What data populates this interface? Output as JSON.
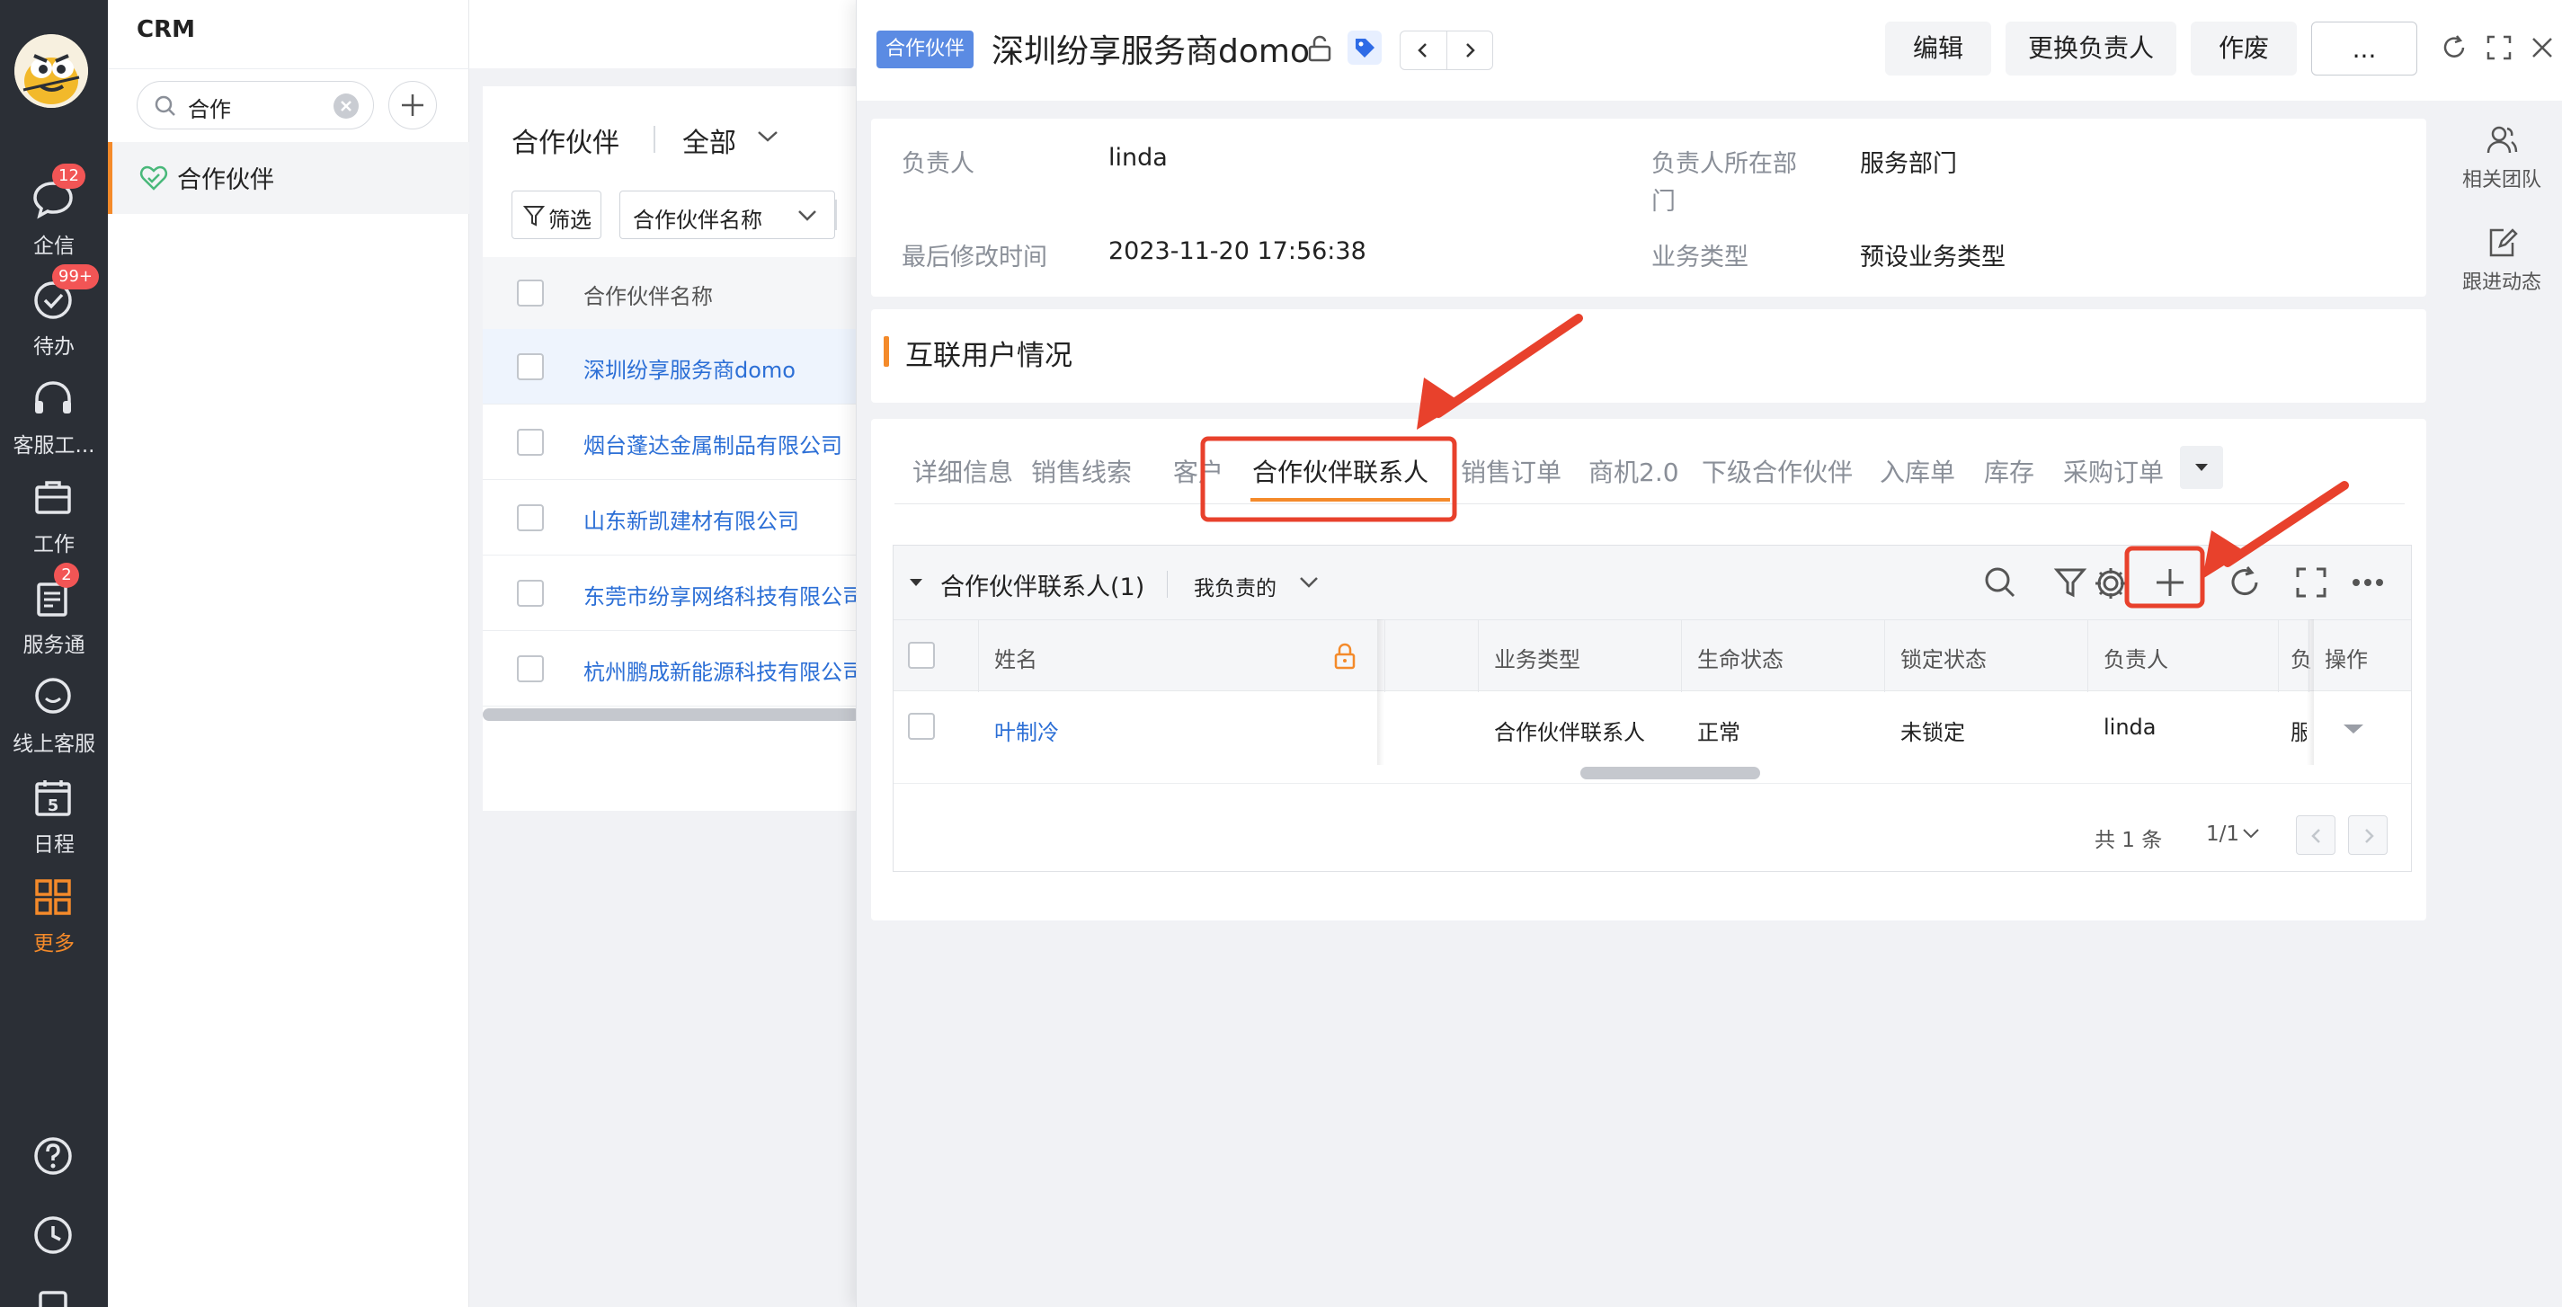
{
  "rail": {
    "items": [
      {
        "label": "企信",
        "badge": "12"
      },
      {
        "label": "待办",
        "badge": "99+"
      },
      {
        "label": "客服工..."
      },
      {
        "label": "工作"
      },
      {
        "label": "服务通",
        "badge": "2"
      },
      {
        "label": "线上客服"
      },
      {
        "label": "日程",
        "day": "5"
      },
      {
        "label": "更多"
      }
    ],
    "accent_color": "#f48a2a"
  },
  "crm": {
    "title": "CRM",
    "search_value": "合作",
    "menu": [
      {
        "label": "合作伙伴"
      }
    ]
  },
  "list": {
    "title": "合作伙伴",
    "view": "全部",
    "filter_label": "筛选",
    "field_select": "合作伙伴名称",
    "column_header": "合作伙伴名称",
    "rows": [
      "深圳纷享服务商domo",
      "烟台蓬达金属制品有限公司",
      "山东新凯建材有限公司",
      "东莞市纷享网络科技有限公司",
      "杭州鹏成新能源科技有限公司"
    ]
  },
  "detail": {
    "type_tag": "合作伙伴",
    "title": "深圳纷享服务商domo",
    "buttons": {
      "edit": "编辑",
      "change_owner": "更换负责人",
      "void": "作废",
      "more": "..."
    },
    "info": {
      "owner_label": "负责人",
      "owner_value": "linda",
      "dept_label_1": "负责人所在部",
      "dept_label_2": "门",
      "dept_value": "服务部门",
      "modified_label": "最后修改时间",
      "modified_value": "2023-11-20 17:56:38",
      "biz_type_label": "业务类型",
      "biz_type_value": "预设业务类型"
    },
    "section_title": "互联用户情况",
    "tabs": [
      "详细信息",
      "销售线索",
      "客户",
      "合作伙伴联系人",
      "销售订单",
      "商机2.0",
      "下级合作伙伴",
      "入库单",
      "库存",
      "采购订单"
    ],
    "active_tab": "合作伙伴联系人",
    "side_actions": [
      "相关团队",
      "跟进动态"
    ]
  },
  "contacts": {
    "title": "合作伙伴联系人(1)",
    "scope": "我负责的",
    "columns": {
      "name": "姓名",
      "biz_type": "业务类型",
      "life_status": "生命状态",
      "lock_status": "锁定状态",
      "owner": "负责人",
      "cut": "负",
      "action": "操作"
    },
    "row": {
      "name": "叶制冷",
      "biz_type": "合作伙伴联系人",
      "life_status": "正常",
      "lock_status": "未锁定",
      "owner": "linda",
      "cut": "服"
    },
    "pagination": {
      "total": "共 1 条",
      "page": "1/1"
    }
  },
  "colors": {
    "link": "#2c6fd6",
    "annotation": "#e8412c",
    "tag_bg": "#5b8be3"
  }
}
